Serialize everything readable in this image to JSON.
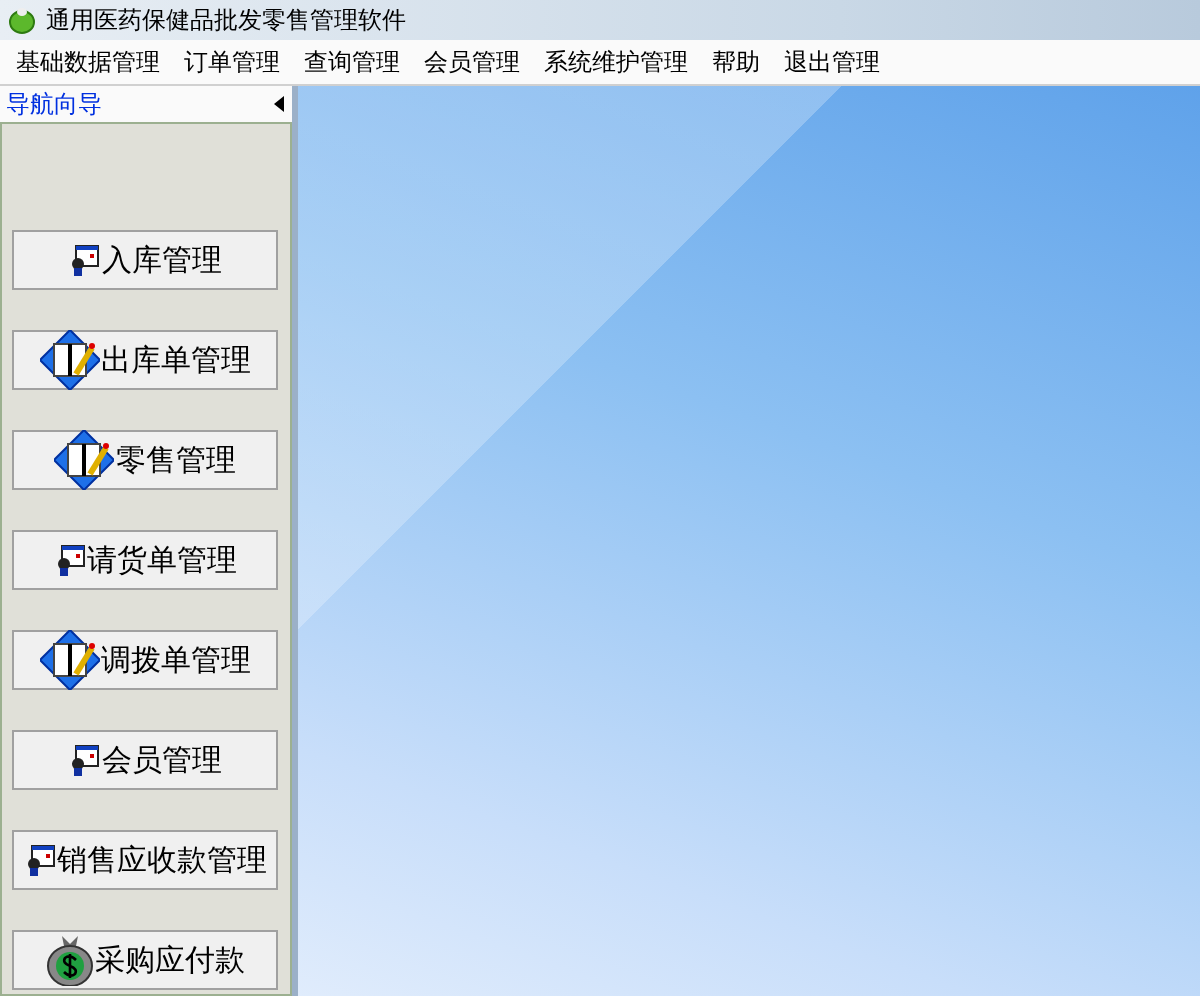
{
  "window": {
    "title": "通用医药保健品批发零售管理软件"
  },
  "menu": [
    "基础数据管理",
    "订单管理",
    "查询管理",
    "会员管理",
    "系统维护管理",
    "帮助",
    "退出管理"
  ],
  "sidebar": {
    "title": "导航向导",
    "items": [
      {
        "label": "入库管理",
        "kind": "form"
      },
      {
        "label": "出库单管理",
        "kind": "edit"
      },
      {
        "label": "零售管理",
        "kind": "edit"
      },
      {
        "label": "请货单管理",
        "kind": "form"
      },
      {
        "label": "调拨单管理",
        "kind": "edit"
      },
      {
        "label": "会员管理",
        "kind": "form"
      },
      {
        "label": "销售应收款管理",
        "kind": "form"
      },
      {
        "label": "采购应付款",
        "kind": "money"
      }
    ]
  }
}
